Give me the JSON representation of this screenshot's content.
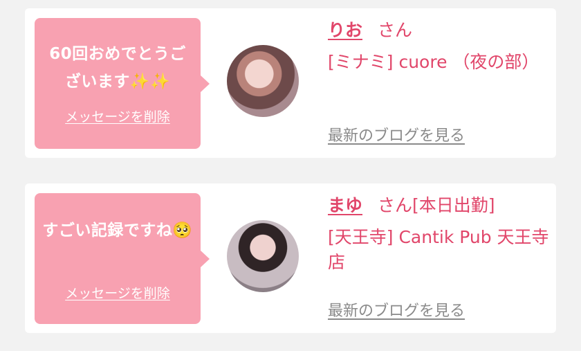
{
  "cards": [
    {
      "message": "60回おめでとうございます✨✨",
      "delete_label": "メッセージを削除",
      "name": "りお",
      "suffix": "さん",
      "shop": "[ミナミ] cuore （夜の部）",
      "blog_label": "最新のブログを見る"
    },
    {
      "message": "すごい記録ですね🥺",
      "delete_label": "メッセージを削除",
      "name": "まゆ",
      "suffix": "さん[本日出勤]",
      "shop": "[天王寺] Cantik Pub 天王寺店",
      "blog_label": "最新のブログを見る"
    }
  ],
  "colors": {
    "bubble": "#f8a1b1",
    "accent": "#e1466a",
    "muted": "#8a8a8a"
  }
}
